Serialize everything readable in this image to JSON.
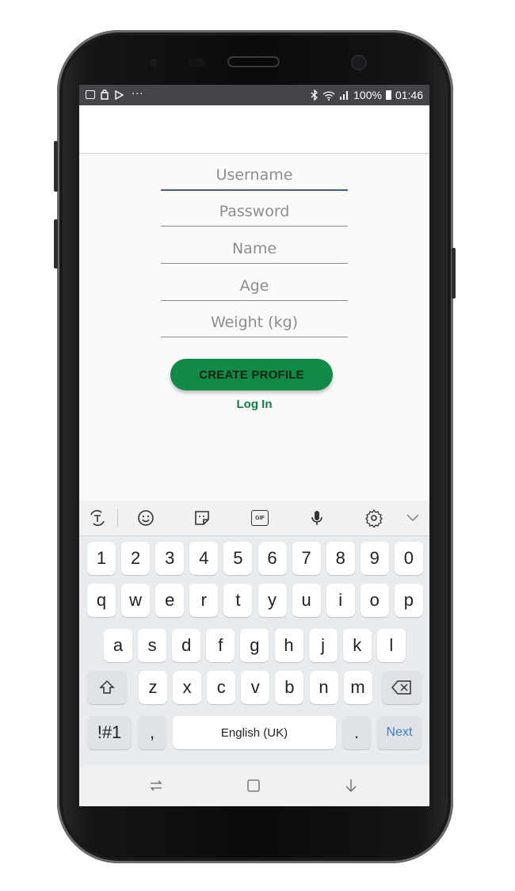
{
  "status_bar": {
    "percent": "100%",
    "time": "01:46",
    "left_icons": [
      "gallery-icon",
      "bag-icon",
      "play-icon",
      "more-icon"
    ],
    "right_icons": [
      "bluetooth-icon",
      "wifi-icon",
      "signal-icon",
      "battery-icon"
    ]
  },
  "form": {
    "username_placeholder": "Username",
    "password_placeholder": "Password",
    "name_placeholder": "Name",
    "age_placeholder": "Age",
    "weight_placeholder": "Weight (kg)"
  },
  "buttons": {
    "create_profile": "CREATE PROFILE",
    "login": "Log In"
  },
  "keyboard": {
    "toolbar_icons": [
      "translate-icon",
      "emoji-icon",
      "sticker-icon",
      "gif-icon",
      "mic-icon",
      "settings-icon",
      "collapse-icon"
    ],
    "gif_label": "GIF",
    "row_numbers": [
      "1",
      "2",
      "3",
      "4",
      "5",
      "6",
      "7",
      "8",
      "9",
      "0"
    ],
    "row_top": [
      "q",
      "w",
      "e",
      "r",
      "t",
      "y",
      "u",
      "i",
      "o",
      "p"
    ],
    "row_middle": [
      "a",
      "s",
      "d",
      "f",
      "g",
      "h",
      "j",
      "k",
      "l"
    ],
    "row_bottom": [
      "z",
      "x",
      "c",
      "v",
      "b",
      "n",
      "m"
    ],
    "symbols_label": "!#1",
    "comma_label": ",",
    "space_label": "English (UK)",
    "period_label": ".",
    "next_label": "Next"
  },
  "colors": {
    "accent_green": "#118a47",
    "link_green": "#0d7f43",
    "status_bar": "#444548",
    "active_underline": "#4a5d8c"
  }
}
